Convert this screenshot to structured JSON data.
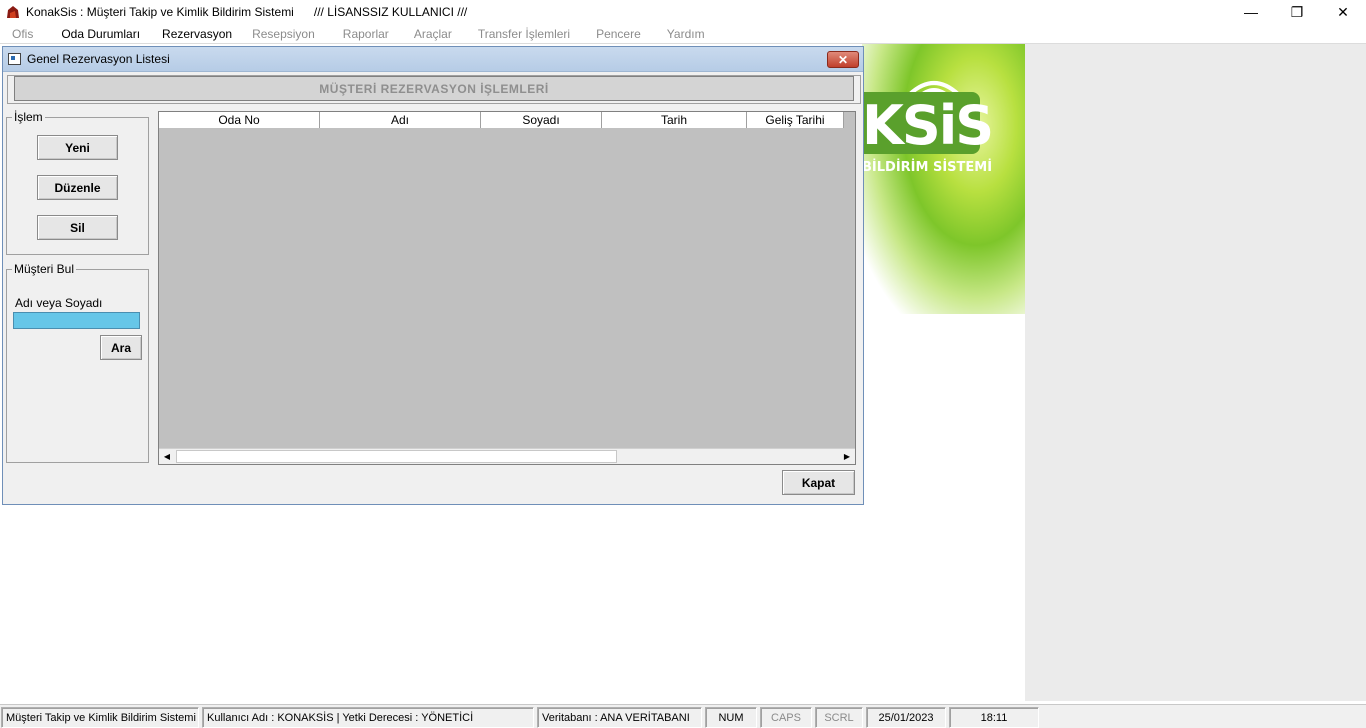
{
  "window": {
    "title": "KonakSis : Müşteri Takip ve Kimlik Bildirim Sistemi",
    "license": "/// LİSANSSIZ KULLANICI ///",
    "minimize": "—",
    "restore": "❐",
    "close": "✕"
  },
  "menu": {
    "items": [
      {
        "label": "Ofis",
        "enabled": false
      },
      {
        "label": "Oda Durumları",
        "enabled": true
      },
      {
        "label": "Rezervasyon",
        "enabled": true
      },
      {
        "label": "Resepsiyon",
        "enabled": false
      },
      {
        "label": "Raporlar",
        "enabled": false
      },
      {
        "label": "Araçlar",
        "enabled": false
      },
      {
        "label": "Transfer İşlemleri",
        "enabled": false
      },
      {
        "label": "Pencere",
        "enabled": false
      },
      {
        "label": "Yardım",
        "enabled": false
      }
    ]
  },
  "logo": {
    "text": "KSiS",
    "subtitle": "BİLDİRİM SİSTEMİ"
  },
  "dialog": {
    "title": "Genel Rezervasyon Listesi",
    "close_label": "✕",
    "banner": "MÜŞTERİ REZERVASYON İŞLEMLERİ",
    "islem_group": {
      "legend": "İşlem",
      "new_label": "Yeni",
      "edit_label": "Düzenle",
      "delete_label": "Sil"
    },
    "search_group": {
      "legend": "Müşteri Bul",
      "field_label": "Adı veya Soyadı",
      "value": "",
      "search_label": "Ara"
    },
    "grid": {
      "columns": [
        "Oda No",
        "Adı",
        "Soyadı",
        "Tarih",
        "Geliş Tarihi"
      ],
      "rows": []
    },
    "kapat_label": "Kapat"
  },
  "status": {
    "app": "Müşteri Takip ve Kimlik Bildirim Sistemi",
    "user": "Kullanıcı Adı : KONAKSİS    |    Yetki Derecesi : YÖNETİCİ",
    "db": "Veritabanı : ANA VERİTABANI",
    "num": "NUM",
    "caps": "CAPS",
    "scrl": "SCRL",
    "date": "25/01/2023",
    "time": "18:11"
  },
  "colors": {
    "accent": "#5aa02c",
    "search_bg": "#66c6e8",
    "grid_bg": "#c0c0c0"
  }
}
